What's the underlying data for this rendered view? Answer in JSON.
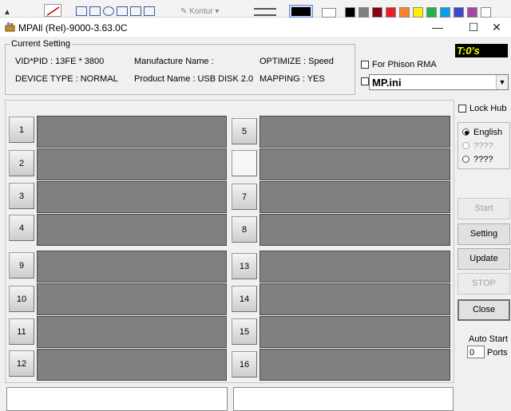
{
  "window": {
    "title": "MPAll (Rel)-9000-3.63.0C",
    "minimize": "—",
    "maximize": "☐",
    "close": "✕"
  },
  "paint_toolbar": {
    "kontur_label": "Kontur"
  },
  "current_setting": {
    "legend": "Current Setting",
    "vid_pid": "VID*PID : 13FE * 3800",
    "device_type": "DEVICE TYPE : NORMAL",
    "manufacture_name": "Manufacture Name :",
    "product_name": "Product Name : USB DISK 2.0",
    "optimize": "OPTIMIZE : Speed",
    "mapping": "MAPPING : YES"
  },
  "timer": "T:0's",
  "for_phison_rma_label": "For Phison RMA",
  "ini_select": {
    "value": "MP.ini",
    "arrow": "▼"
  },
  "ports": [
    {
      "label": "1"
    },
    {
      "label": "2"
    },
    {
      "label": "3"
    },
    {
      "label": "4"
    },
    {
      "label": "9"
    },
    {
      "label": "10"
    },
    {
      "label": "11"
    },
    {
      "label": "12"
    },
    {
      "label": "5"
    },
    {
      "label": ""
    },
    {
      "label": "7"
    },
    {
      "label": "8"
    },
    {
      "label": "13"
    },
    {
      "label": "14"
    },
    {
      "label": "15"
    },
    {
      "label": "16"
    }
  ],
  "lock_hub_label": "Lock Hub",
  "languages": [
    {
      "label": "English",
      "selected": true
    },
    {
      "label": "????",
      "selected": false
    },
    {
      "label": "????",
      "selected": false
    }
  ],
  "buttons": {
    "start": "Start",
    "setting": "Setting",
    "update": "Update",
    "stop": "STOP",
    "close": "Close"
  },
  "auto_start": {
    "label": "Auto Start",
    "value": "0",
    "ports_label": "Ports"
  },
  "colors": {
    "port_bar": "#808080",
    "timer_bg": "#000000",
    "timer_fg": "#ffff00"
  }
}
